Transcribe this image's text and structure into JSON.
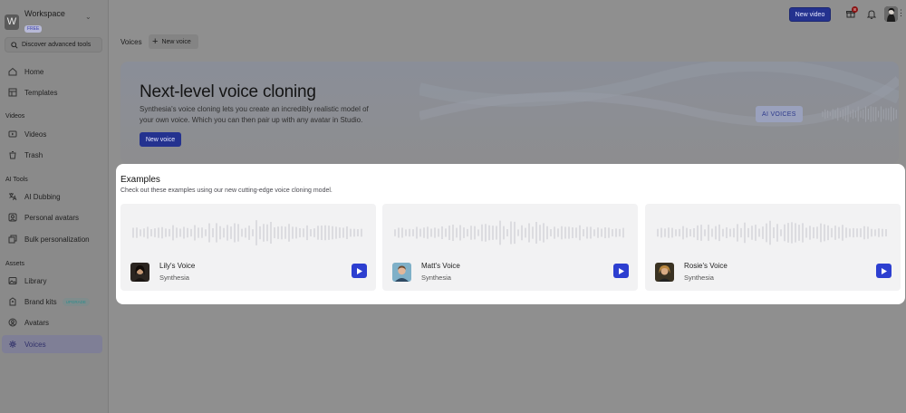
{
  "sidebar": {
    "workspace_initial": "W",
    "workspace_name": "Workspace",
    "workspace_plan": "FREE",
    "discover_label": "Discover advanced tools",
    "items": {
      "home": "Home",
      "templates": "Templates",
      "videos": "Videos",
      "trash": "Trash",
      "ai_dubbing": "AI Dubbing",
      "personal_avatars": "Personal avatars",
      "bulk_personalization": "Bulk personalization",
      "library": "Library",
      "brand_kits": "Brand kits",
      "avatars": "Avatars",
      "voices": "Voices"
    },
    "sections": {
      "videos": "Videos",
      "ai_tools": "AI Tools",
      "assets": "Assets"
    },
    "upgrade_badge": "UPGRADE"
  },
  "topbar": {
    "new_video": "New video",
    "gift_count": "8"
  },
  "breadcrumb": {
    "current": "Voices",
    "new_voice": "New voice"
  },
  "hero": {
    "title": "Next-level voice cloning",
    "description": "Synthesia's voice cloning lets you create an incredibly realistic model of your own voice. Which you can then pair up with any avatar in Studio.",
    "button": "New voice",
    "pill": "AI VOICES"
  },
  "examples": {
    "title": "Examples",
    "subtitle": "Check out these examples using our new cutting-edge voice cloning model.",
    "cards": [
      {
        "name": "Lily's Voice",
        "by": "Synthesia"
      },
      {
        "name": "Matt's Voice",
        "by": "Synthesia"
      },
      {
        "name": "Rosie's Voice",
        "by": "Synthesia"
      }
    ]
  },
  "colors": {
    "accent": "#2d3fd0",
    "overlay": "#8f8f8f",
    "panel": "#ffffff"
  }
}
